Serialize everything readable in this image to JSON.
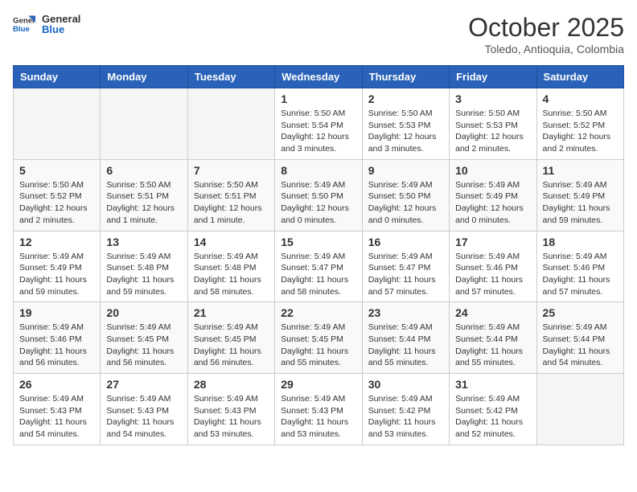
{
  "logo": {
    "line1": "General",
    "line2": "Blue"
  },
  "title": "October 2025",
  "location": "Toledo, Antioquia, Colombia",
  "days_of_week": [
    "Sunday",
    "Monday",
    "Tuesday",
    "Wednesday",
    "Thursday",
    "Friday",
    "Saturday"
  ],
  "weeks": [
    [
      {
        "day": "",
        "info": ""
      },
      {
        "day": "",
        "info": ""
      },
      {
        "day": "",
        "info": ""
      },
      {
        "day": "1",
        "info": "Sunrise: 5:50 AM\nSunset: 5:54 PM\nDaylight: 12 hours\nand 3 minutes."
      },
      {
        "day": "2",
        "info": "Sunrise: 5:50 AM\nSunset: 5:53 PM\nDaylight: 12 hours\nand 3 minutes."
      },
      {
        "day": "3",
        "info": "Sunrise: 5:50 AM\nSunset: 5:53 PM\nDaylight: 12 hours\nand 2 minutes."
      },
      {
        "day": "4",
        "info": "Sunrise: 5:50 AM\nSunset: 5:52 PM\nDaylight: 12 hours\nand 2 minutes."
      }
    ],
    [
      {
        "day": "5",
        "info": "Sunrise: 5:50 AM\nSunset: 5:52 PM\nDaylight: 12 hours\nand 2 minutes."
      },
      {
        "day": "6",
        "info": "Sunrise: 5:50 AM\nSunset: 5:51 PM\nDaylight: 12 hours\nand 1 minute."
      },
      {
        "day": "7",
        "info": "Sunrise: 5:50 AM\nSunset: 5:51 PM\nDaylight: 12 hours\nand 1 minute."
      },
      {
        "day": "8",
        "info": "Sunrise: 5:49 AM\nSunset: 5:50 PM\nDaylight: 12 hours\nand 0 minutes."
      },
      {
        "day": "9",
        "info": "Sunrise: 5:49 AM\nSunset: 5:50 PM\nDaylight: 12 hours\nand 0 minutes."
      },
      {
        "day": "10",
        "info": "Sunrise: 5:49 AM\nSunset: 5:49 PM\nDaylight: 12 hours\nand 0 minutes."
      },
      {
        "day": "11",
        "info": "Sunrise: 5:49 AM\nSunset: 5:49 PM\nDaylight: 11 hours\nand 59 minutes."
      }
    ],
    [
      {
        "day": "12",
        "info": "Sunrise: 5:49 AM\nSunset: 5:49 PM\nDaylight: 11 hours\nand 59 minutes."
      },
      {
        "day": "13",
        "info": "Sunrise: 5:49 AM\nSunset: 5:48 PM\nDaylight: 11 hours\nand 59 minutes."
      },
      {
        "day": "14",
        "info": "Sunrise: 5:49 AM\nSunset: 5:48 PM\nDaylight: 11 hours\nand 58 minutes."
      },
      {
        "day": "15",
        "info": "Sunrise: 5:49 AM\nSunset: 5:47 PM\nDaylight: 11 hours\nand 58 minutes."
      },
      {
        "day": "16",
        "info": "Sunrise: 5:49 AM\nSunset: 5:47 PM\nDaylight: 11 hours\nand 57 minutes."
      },
      {
        "day": "17",
        "info": "Sunrise: 5:49 AM\nSunset: 5:46 PM\nDaylight: 11 hours\nand 57 minutes."
      },
      {
        "day": "18",
        "info": "Sunrise: 5:49 AM\nSunset: 5:46 PM\nDaylight: 11 hours\nand 57 minutes."
      }
    ],
    [
      {
        "day": "19",
        "info": "Sunrise: 5:49 AM\nSunset: 5:46 PM\nDaylight: 11 hours\nand 56 minutes."
      },
      {
        "day": "20",
        "info": "Sunrise: 5:49 AM\nSunset: 5:45 PM\nDaylight: 11 hours\nand 56 minutes."
      },
      {
        "day": "21",
        "info": "Sunrise: 5:49 AM\nSunset: 5:45 PM\nDaylight: 11 hours\nand 56 minutes."
      },
      {
        "day": "22",
        "info": "Sunrise: 5:49 AM\nSunset: 5:45 PM\nDaylight: 11 hours\nand 55 minutes."
      },
      {
        "day": "23",
        "info": "Sunrise: 5:49 AM\nSunset: 5:44 PM\nDaylight: 11 hours\nand 55 minutes."
      },
      {
        "day": "24",
        "info": "Sunrise: 5:49 AM\nSunset: 5:44 PM\nDaylight: 11 hours\nand 55 minutes."
      },
      {
        "day": "25",
        "info": "Sunrise: 5:49 AM\nSunset: 5:44 PM\nDaylight: 11 hours\nand 54 minutes."
      }
    ],
    [
      {
        "day": "26",
        "info": "Sunrise: 5:49 AM\nSunset: 5:43 PM\nDaylight: 11 hours\nand 54 minutes."
      },
      {
        "day": "27",
        "info": "Sunrise: 5:49 AM\nSunset: 5:43 PM\nDaylight: 11 hours\nand 54 minutes."
      },
      {
        "day": "28",
        "info": "Sunrise: 5:49 AM\nSunset: 5:43 PM\nDaylight: 11 hours\nand 53 minutes."
      },
      {
        "day": "29",
        "info": "Sunrise: 5:49 AM\nSunset: 5:43 PM\nDaylight: 11 hours\nand 53 minutes."
      },
      {
        "day": "30",
        "info": "Sunrise: 5:49 AM\nSunset: 5:42 PM\nDaylight: 11 hours\nand 53 minutes."
      },
      {
        "day": "31",
        "info": "Sunrise: 5:49 AM\nSunset: 5:42 PM\nDaylight: 11 hours\nand 52 minutes."
      },
      {
        "day": "",
        "info": ""
      }
    ]
  ]
}
